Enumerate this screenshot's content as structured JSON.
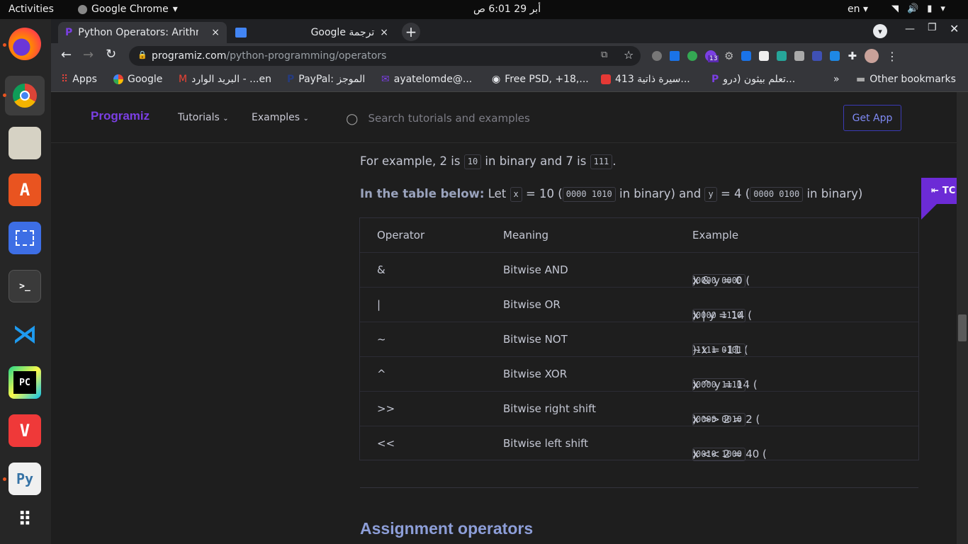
{
  "topbar": {
    "activities": "Activities",
    "app": "Google Chrome",
    "clock": "أبر 29  6:01 ص",
    "lang": "en"
  },
  "tabs": [
    {
      "label": "Python Operators: Arithm",
      "close": "×"
    },
    {
      "label": "Google ترجمة",
      "close": "×"
    }
  ],
  "new_tab": "+",
  "omnibox": {
    "domain": "programiz.com",
    "path": "/python-programming/operators"
  },
  "bookmarks": [
    "Apps",
    "Google",
    "البريد الوارد - ...en",
    "PayPal: الموجز",
    "ayatelomde@...",
    "Free PSD, +18,...",
    "413 سيرة ذاتية...",
    "تعلم بيثون (درو...",
    "Other bookmarks"
  ],
  "bookmarks_more": "»",
  "extensions_badge": "13",
  "site": {
    "logo": "Programiz",
    "nav": [
      "Tutorials",
      "Examples"
    ],
    "search_placeholder": "Search tutorials and examples",
    "get_app": "Get App",
    "toc_label": "TC"
  },
  "content": {
    "p1": {
      "a": "For example, 2 is",
      "c1": "10",
      "b": "in binary and 7 is",
      "c2": "111",
      "c": "."
    },
    "p2": {
      "bold": "In the table below:",
      "a": "Let",
      "x": "x",
      "b": "= 10 (",
      "xb": "0000 1010",
      "c": "in binary) and",
      "y": "y",
      "d": "= 4 (",
      "yb": "0000 0100",
      "e": "in binary)"
    },
    "table": {
      "headers": [
        "Operator",
        "Meaning",
        "Example"
      ],
      "rows": [
        {
          "op": "&",
          "meaning": "Bitwise AND",
          "ex": "x & y = 0 (",
          "code": "0000 0000",
          "end": ")"
        },
        {
          "op": "|",
          "meaning": "Bitwise OR",
          "ex": "x | y = 14 (",
          "code": "0000 1110",
          "end": ")"
        },
        {
          "op": "~",
          "meaning": "Bitwise NOT",
          "ex": "~x = -11 (",
          "code": "1111 0101",
          "end": ")"
        },
        {
          "op": "^",
          "meaning": "Bitwise XOR",
          "ex": "x ^ y = 14 (",
          "code": "0000 1110",
          "end": ")"
        },
        {
          "op": ">>",
          "meaning": "Bitwise right shift",
          "ex": "x >> 2 = 2 (",
          "code": "0000 0010",
          "end": ")"
        },
        {
          "op": "<<",
          "meaning": "Bitwise left shift",
          "ex": "x << 2 = 40 (",
          "code": "0010 1000",
          "end": ")"
        }
      ]
    },
    "heading": "Assignment operators"
  },
  "dock": [
    {
      "name": "firefox-icon",
      "color": "#e66000"
    },
    {
      "name": "chrome-icon",
      "color": "#4285f4"
    },
    {
      "name": "files-icon",
      "color": "#d6d2c4"
    },
    {
      "name": "software-icon",
      "color": "#e95420"
    },
    {
      "name": "screenshot-icon",
      "color": "#3d6ee5"
    },
    {
      "name": "terminal-icon",
      "color": "#3a3a3a"
    },
    {
      "name": "vscode-icon",
      "color": "#0078d4"
    },
    {
      "name": "pycharm-icon",
      "color": "#21d789"
    },
    {
      "name": "vivaldi-icon",
      "color": "#ef3939"
    },
    {
      "name": "python-file-icon",
      "color": "#f0f0f0"
    },
    {
      "name": "apps-grid-icon",
      "color": "#262626"
    }
  ]
}
